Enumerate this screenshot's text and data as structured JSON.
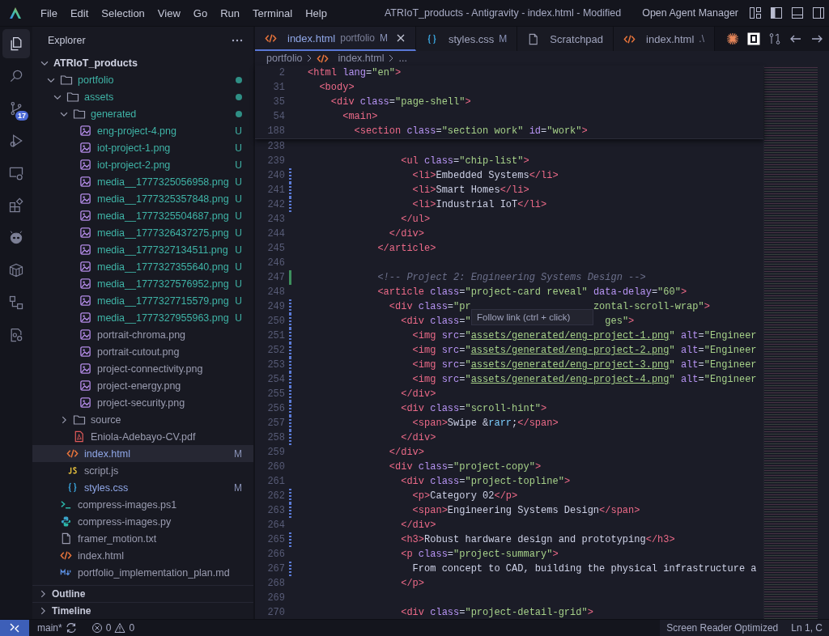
{
  "titlebar": {
    "menus": [
      "File",
      "Edit",
      "Selection",
      "View",
      "Go",
      "Run",
      "Terminal",
      "Help"
    ],
    "title": "ATRIoT_products - Antigravity - index.html - Modified",
    "agent_button": "Open Agent Manager"
  },
  "activity_bar": {
    "items": [
      {
        "selected": true
      },
      {
        "selected": false
      },
      {
        "selected": false,
        "badge": "17"
      },
      {
        "selected": false
      },
      {
        "selected": false
      },
      {
        "selected": false
      },
      {
        "selected": false
      },
      {
        "selected": false
      },
      {
        "selected": false
      },
      {
        "selected": false
      }
    ]
  },
  "explorer": {
    "title": "Explorer",
    "tree": [
      {
        "kind": "folder",
        "label": "ATRIoT_products",
        "expanded": true,
        "dirty": false,
        "selected": false,
        "children": [
          {
            "kind": "folder",
            "label": "portfolio",
            "expanded": true,
            "dirty": true,
            "selected": false,
            "children": [
              {
                "kind": "folder",
                "label": "assets",
                "expanded": true,
                "dirty": true,
                "selected": false,
                "children": [
                  {
                    "kind": "folder",
                    "label": "generated",
                    "expanded": true,
                    "dirty": true,
                    "selected": false,
                    "children": [
                      {
                        "kind": "image",
                        "label": "eng-project-4.png",
                        "status": "U",
                        "selected": false
                      },
                      {
                        "kind": "image",
                        "label": "iot-project-1.png",
                        "status": "U",
                        "selected": false
                      },
                      {
                        "kind": "image",
                        "label": "iot-project-2.png",
                        "status": "U",
                        "selected": false
                      },
                      {
                        "kind": "image",
                        "label": "media__1777325056958.png",
                        "status": "U",
                        "selected": false
                      },
                      {
                        "kind": "image",
                        "label": "media__1777325357848.png",
                        "status": "U",
                        "selected": false
                      },
                      {
                        "kind": "image",
                        "label": "media__1777325504687.png",
                        "status": "U",
                        "selected": false
                      },
                      {
                        "kind": "image",
                        "label": "media__1777326437275.png",
                        "status": "U",
                        "selected": false
                      },
                      {
                        "kind": "image",
                        "label": "media__1777327134511.png",
                        "status": "U",
                        "selected": false
                      },
                      {
                        "kind": "image",
                        "label": "media__1777327355640.png",
                        "status": "U",
                        "selected": false
                      },
                      {
                        "kind": "image",
                        "label": "media__1777327576952.png",
                        "status": "U",
                        "selected": false
                      },
                      {
                        "kind": "image",
                        "label": "media__1777327715579.png",
                        "status": "U",
                        "selected": false
                      },
                      {
                        "kind": "image",
                        "label": "media__1777327955963.png",
                        "status": "U",
                        "selected": false
                      },
                      {
                        "kind": "image",
                        "label": "portrait-chroma.png",
                        "selected": false
                      },
                      {
                        "kind": "image",
                        "label": "portrait-cutout.png",
                        "selected": false
                      },
                      {
                        "kind": "image",
                        "label": "project-connectivity.png",
                        "selected": false
                      },
                      {
                        "kind": "image",
                        "label": "project-energy.png",
                        "selected": false
                      },
                      {
                        "kind": "image",
                        "label": "project-security.png",
                        "selected": false
                      }
                    ]
                  },
                  {
                    "kind": "folder",
                    "label": "source",
                    "expanded": false,
                    "dirty": false,
                    "selected": false
                  },
                  {
                    "kind": "pdf",
                    "label": "Eniola-Adebayo-CV.pdf",
                    "selected": false
                  }
                ]
              },
              {
                "kind": "html",
                "label": "index.html",
                "status": "M",
                "selected": true
              },
              {
                "kind": "js",
                "label": "script.js",
                "selected": false
              },
              {
                "kind": "css",
                "label": "styles.css",
                "status": "M",
                "selected": false
              }
            ]
          },
          {
            "kind": "ps1",
            "label": "compress-images.ps1",
            "selected": false
          },
          {
            "kind": "py",
            "label": "compress-images.py",
            "selected": false
          },
          {
            "kind": "txt",
            "label": "framer_motion.txt",
            "selected": false
          },
          {
            "kind": "html",
            "label": "index.html",
            "selected": false
          },
          {
            "kind": "md",
            "label": "portfolio_implementation_plan.md",
            "selected": false
          }
        ]
      }
    ],
    "sections": [
      {
        "label": "Outline",
        "expanded": false
      },
      {
        "label": "Timeline",
        "expanded": false
      }
    ]
  },
  "tabs": [
    {
      "kind": "html",
      "label": "index.html",
      "description": "portfolio",
      "status": "M",
      "selected": true
    },
    {
      "kind": "css",
      "label": "styles.css",
      "status": "M",
      "selected": false
    },
    {
      "kind": "txt",
      "label": "Scratchpad",
      "selected": false
    },
    {
      "kind": "html",
      "label": "index.html",
      "description": ".\\",
      "selected": false
    }
  ],
  "breadcrumb": [
    {
      "kind": "folder",
      "label": "portfolio"
    },
    {
      "kind": "html",
      "label": "index.html"
    },
    {
      "kind": "symbol",
      "label": "..."
    }
  ],
  "editor": {
    "tooltip": "Follow link (ctrl + click)",
    "sticky_lines": [
      {
        "number": "2",
        "tokens": [
          {
            "kind": "tag",
            "text": "<html"
          },
          {
            "kind": "attr",
            "text": " lang"
          },
          {
            "kind": "punct",
            "text": "="
          },
          {
            "kind": "string",
            "text": "\"en\""
          },
          {
            "kind": "tag",
            "text": ">"
          }
        ]
      },
      {
        "number": "31",
        "tokens": [
          {
            "kind": "tag",
            "text": "  <body>"
          }
        ]
      },
      {
        "number": "35",
        "tokens": [
          {
            "kind": "tag",
            "text": "    <div"
          },
          {
            "kind": "attr",
            "text": " class"
          },
          {
            "kind": "punct",
            "text": "="
          },
          {
            "kind": "string",
            "text": "\"page-shell\""
          },
          {
            "kind": "tag",
            "text": ">"
          }
        ]
      },
      {
        "number": "54",
        "tokens": [
          {
            "kind": "tag",
            "text": "      <main>"
          }
        ]
      },
      {
        "number": "188",
        "tokens": [
          {
            "kind": "tag",
            "text": "        <section"
          },
          {
            "kind": "attr",
            "text": " class"
          },
          {
            "kind": "punct",
            "text": "="
          },
          {
            "kind": "string",
            "text": "\"section work\""
          },
          {
            "kind": "attr",
            "text": " id"
          },
          {
            "kind": "punct",
            "text": "="
          },
          {
            "kind": "string",
            "text": "\"work\""
          },
          {
            "kind": "tag",
            "text": ">"
          }
        ]
      }
    ],
    "lines": [
      {
        "number": "238",
        "modified": false,
        "added": false
      },
      {
        "number": "239",
        "modified": false,
        "added": false,
        "tokens": [
          {
            "kind": "tag",
            "text": "                <ul"
          },
          {
            "kind": "attr",
            "text": " class"
          },
          {
            "kind": "punct",
            "text": "="
          },
          {
            "kind": "string",
            "text": "\"chip-list\""
          },
          {
            "kind": "tag",
            "text": ">"
          }
        ]
      },
      {
        "number": "240",
        "modified": true,
        "added": false,
        "tokens": [
          {
            "kind": "tag",
            "text": "                  <li>"
          },
          {
            "kind": "text",
            "text": "Embedded Systems"
          },
          {
            "kind": "tag",
            "text": "</li>"
          }
        ]
      },
      {
        "number": "241",
        "modified": true,
        "added": false,
        "tokens": [
          {
            "kind": "tag",
            "text": "                  <li>"
          },
          {
            "kind": "text",
            "text": "Smart Homes"
          },
          {
            "kind": "tag",
            "text": "</li>"
          }
        ]
      },
      {
        "number": "242",
        "modified": true,
        "added": false,
        "tokens": [
          {
            "kind": "tag",
            "text": "                  <li>"
          },
          {
            "kind": "text",
            "text": "Industrial IoT"
          },
          {
            "kind": "tag",
            "text": "</li>"
          }
        ]
      },
      {
        "number": "243",
        "modified": false,
        "added": false,
        "tokens": [
          {
            "kind": "tag",
            "text": "                </ul>"
          }
        ]
      },
      {
        "number": "244",
        "modified": false,
        "added": false,
        "tokens": [
          {
            "kind": "tag",
            "text": "              </div>"
          }
        ]
      },
      {
        "number": "245",
        "modified": false,
        "added": false,
        "tokens": [
          {
            "kind": "tag",
            "text": "            </article>"
          }
        ]
      },
      {
        "number": "246",
        "modified": false,
        "added": false
      },
      {
        "number": "247",
        "modified": false,
        "added": true,
        "tokens": [
          {
            "kind": "comment",
            "text": "            <!-- Project 2: Engineering Systems Design -->"
          }
        ]
      },
      {
        "number": "248",
        "modified": false,
        "added": false,
        "tokens": [
          {
            "kind": "tag",
            "text": "            <article"
          },
          {
            "kind": "attr",
            "text": " class"
          },
          {
            "kind": "punct",
            "text": "="
          },
          {
            "kind": "string",
            "text": "\"project-card reveal\""
          },
          {
            "kind": "attr",
            "text": " data-delay"
          },
          {
            "kind": "punct",
            "text": "="
          },
          {
            "kind": "string",
            "text": "\"60\""
          },
          {
            "kind": "tag",
            "text": ">"
          }
        ]
      },
      {
        "number": "249",
        "modified": true,
        "added": false,
        "tokens": [
          {
            "kind": "tag",
            "text": "              <div"
          },
          {
            "kind": "attr",
            "text": " class"
          },
          {
            "kind": "punct",
            "text": "="
          },
          {
            "kind": "string",
            "text": "\"pr"
          },
          {
            "kind": "covered"
          },
          {
            "kind": "string",
            "text": "zontal-scroll-wrap\""
          },
          {
            "kind": "tag",
            "text": ">"
          }
        ]
      },
      {
        "number": "250",
        "modified": true,
        "added": false,
        "tokens": [
          {
            "kind": "tag",
            "text": "                <div"
          },
          {
            "kind": "attr",
            "text": " class"
          },
          {
            "kind": "punct",
            "text": "="
          },
          {
            "kind": "string",
            "text": "\""
          },
          {
            "kind": "covered"
          },
          {
            "kind": "string",
            "text": "ges\""
          },
          {
            "kind": "tag",
            "text": ">"
          }
        ]
      },
      {
        "number": "251",
        "modified": true,
        "added": false,
        "tokens": [
          {
            "kind": "tag",
            "text": "                  <img"
          },
          {
            "kind": "attr",
            "text": " src"
          },
          {
            "kind": "punct",
            "text": "="
          },
          {
            "kind": "string",
            "text": "\""
          },
          {
            "kind": "link",
            "text": "assets/generated/eng-project-1.png"
          },
          {
            "kind": "string",
            "text": "\""
          },
          {
            "kind": "attr",
            "text": " alt"
          },
          {
            "kind": "punct",
            "text": "="
          },
          {
            "kind": "string",
            "text": "\"Engineer"
          }
        ]
      },
      {
        "number": "252",
        "modified": true,
        "added": false,
        "tokens": [
          {
            "kind": "tag",
            "text": "                  <img"
          },
          {
            "kind": "attr",
            "text": " src"
          },
          {
            "kind": "punct",
            "text": "="
          },
          {
            "kind": "string",
            "text": "\""
          },
          {
            "kind": "link",
            "text": "assets/generated/eng-project-2.png"
          },
          {
            "kind": "string",
            "text": "\""
          },
          {
            "kind": "attr",
            "text": " alt"
          },
          {
            "kind": "punct",
            "text": "="
          },
          {
            "kind": "string",
            "text": "\"Engineer"
          }
        ]
      },
      {
        "number": "253",
        "modified": true,
        "added": false,
        "tokens": [
          {
            "kind": "tag",
            "text": "                  <img"
          },
          {
            "kind": "attr",
            "text": " src"
          },
          {
            "kind": "punct",
            "text": "="
          },
          {
            "kind": "string",
            "text": "\""
          },
          {
            "kind": "link",
            "text": "assets/generated/eng-project-3.png"
          },
          {
            "kind": "string",
            "text": "\""
          },
          {
            "kind": "attr",
            "text": " alt"
          },
          {
            "kind": "punct",
            "text": "="
          },
          {
            "kind": "string",
            "text": "\"Engineer"
          }
        ]
      },
      {
        "number": "254",
        "modified": true,
        "added": false,
        "tokens": [
          {
            "kind": "tag",
            "text": "                  <img"
          },
          {
            "kind": "attr",
            "text": " src"
          },
          {
            "kind": "punct",
            "text": "="
          },
          {
            "kind": "string",
            "text": "\""
          },
          {
            "kind": "link",
            "text": "assets/generated/eng-project-4.png"
          },
          {
            "kind": "string",
            "text": "\""
          },
          {
            "kind": "attr",
            "text": " alt"
          },
          {
            "kind": "punct",
            "text": "="
          },
          {
            "kind": "string",
            "text": "\"Engineer"
          }
        ]
      },
      {
        "number": "255",
        "modified": true,
        "added": false,
        "tokens": [
          {
            "kind": "tag",
            "text": "                </div>"
          }
        ]
      },
      {
        "number": "256",
        "modified": true,
        "added": false,
        "tokens": [
          {
            "kind": "tag",
            "text": "                <div"
          },
          {
            "kind": "attr",
            "text": " class"
          },
          {
            "kind": "punct",
            "text": "="
          },
          {
            "kind": "string",
            "text": "\"scroll-hint\""
          },
          {
            "kind": "tag",
            "text": ">"
          }
        ]
      },
      {
        "number": "257",
        "modified": true,
        "added": false,
        "tokens": [
          {
            "kind": "tag",
            "text": "                  <span>"
          },
          {
            "kind": "text",
            "text": "Swipe "
          },
          {
            "kind": "punct",
            "text": "&"
          },
          {
            "kind": "entity",
            "text": "rarr"
          },
          {
            "kind": "punct",
            "text": ";"
          },
          {
            "kind": "tag",
            "text": "</span>"
          }
        ]
      },
      {
        "number": "258",
        "modified": true,
        "added": false,
        "tokens": [
          {
            "kind": "tag",
            "text": "                </div>"
          }
        ]
      },
      {
        "number": "259",
        "modified": false,
        "added": false,
        "tokens": [
          {
            "kind": "tag",
            "text": "              </div>"
          }
        ]
      },
      {
        "number": "260",
        "modified": false,
        "added": false,
        "tokens": [
          {
            "kind": "tag",
            "text": "              <div"
          },
          {
            "kind": "attr",
            "text": " class"
          },
          {
            "kind": "punct",
            "text": "="
          },
          {
            "kind": "string",
            "text": "\"project-copy\""
          },
          {
            "kind": "tag",
            "text": ">"
          }
        ]
      },
      {
        "number": "261",
        "modified": false,
        "added": false,
        "tokens": [
          {
            "kind": "tag",
            "text": "                <div"
          },
          {
            "kind": "attr",
            "text": " class"
          },
          {
            "kind": "punct",
            "text": "="
          },
          {
            "kind": "string",
            "text": "\"project-topline\""
          },
          {
            "kind": "tag",
            "text": ">"
          }
        ]
      },
      {
        "number": "262",
        "modified": true,
        "added": false,
        "tokens": [
          {
            "kind": "tag",
            "text": "                  <p>"
          },
          {
            "kind": "text",
            "text": "Category 02"
          },
          {
            "kind": "tag",
            "text": "</p>"
          }
        ]
      },
      {
        "number": "263",
        "modified": true,
        "added": false,
        "tokens": [
          {
            "kind": "tag",
            "text": "                  <span>"
          },
          {
            "kind": "text",
            "text": "Engineering Systems Design"
          },
          {
            "kind": "tag",
            "text": "</span>"
          }
        ]
      },
      {
        "number": "264",
        "modified": false,
        "added": false,
        "tokens": [
          {
            "kind": "tag",
            "text": "                </div>"
          }
        ]
      },
      {
        "number": "265",
        "modified": true,
        "added": false,
        "tokens": [
          {
            "kind": "tag",
            "text": "                <h3>"
          },
          {
            "kind": "text",
            "text": "Robust hardware design and prototyping"
          },
          {
            "kind": "tag",
            "text": "</h3>"
          }
        ]
      },
      {
        "number": "266",
        "modified": false,
        "added": false,
        "tokens": [
          {
            "kind": "tag",
            "text": "                <p"
          },
          {
            "kind": "attr",
            "text": " class"
          },
          {
            "kind": "punct",
            "text": "="
          },
          {
            "kind": "string",
            "text": "\"project-summary\""
          },
          {
            "kind": "tag",
            "text": ">"
          }
        ]
      },
      {
        "number": "267",
        "modified": true,
        "added": false,
        "tokens": [
          {
            "kind": "text",
            "text": "                  From concept to CAD, building the physical infrastructure a"
          }
        ]
      },
      {
        "number": "268",
        "modified": false,
        "added": false,
        "tokens": [
          {
            "kind": "tag",
            "text": "                </p>"
          }
        ]
      },
      {
        "number": "269",
        "modified": false,
        "added": false
      },
      {
        "number": "270",
        "modified": false,
        "added": false,
        "tokens": [
          {
            "kind": "tag",
            "text": "                <div"
          },
          {
            "kind": "attr",
            "text": " class"
          },
          {
            "kind": "punct",
            "text": "="
          },
          {
            "kind": "string",
            "text": "\"project-detail-grid\""
          },
          {
            "kind": "tag",
            "text": ">"
          }
        ]
      }
    ]
  },
  "status_bar": {
    "branch": "main*",
    "errors": "0",
    "warnings": "0",
    "right": [
      "Screen Reader Optimized",
      "Ln 1, C"
    ]
  }
}
